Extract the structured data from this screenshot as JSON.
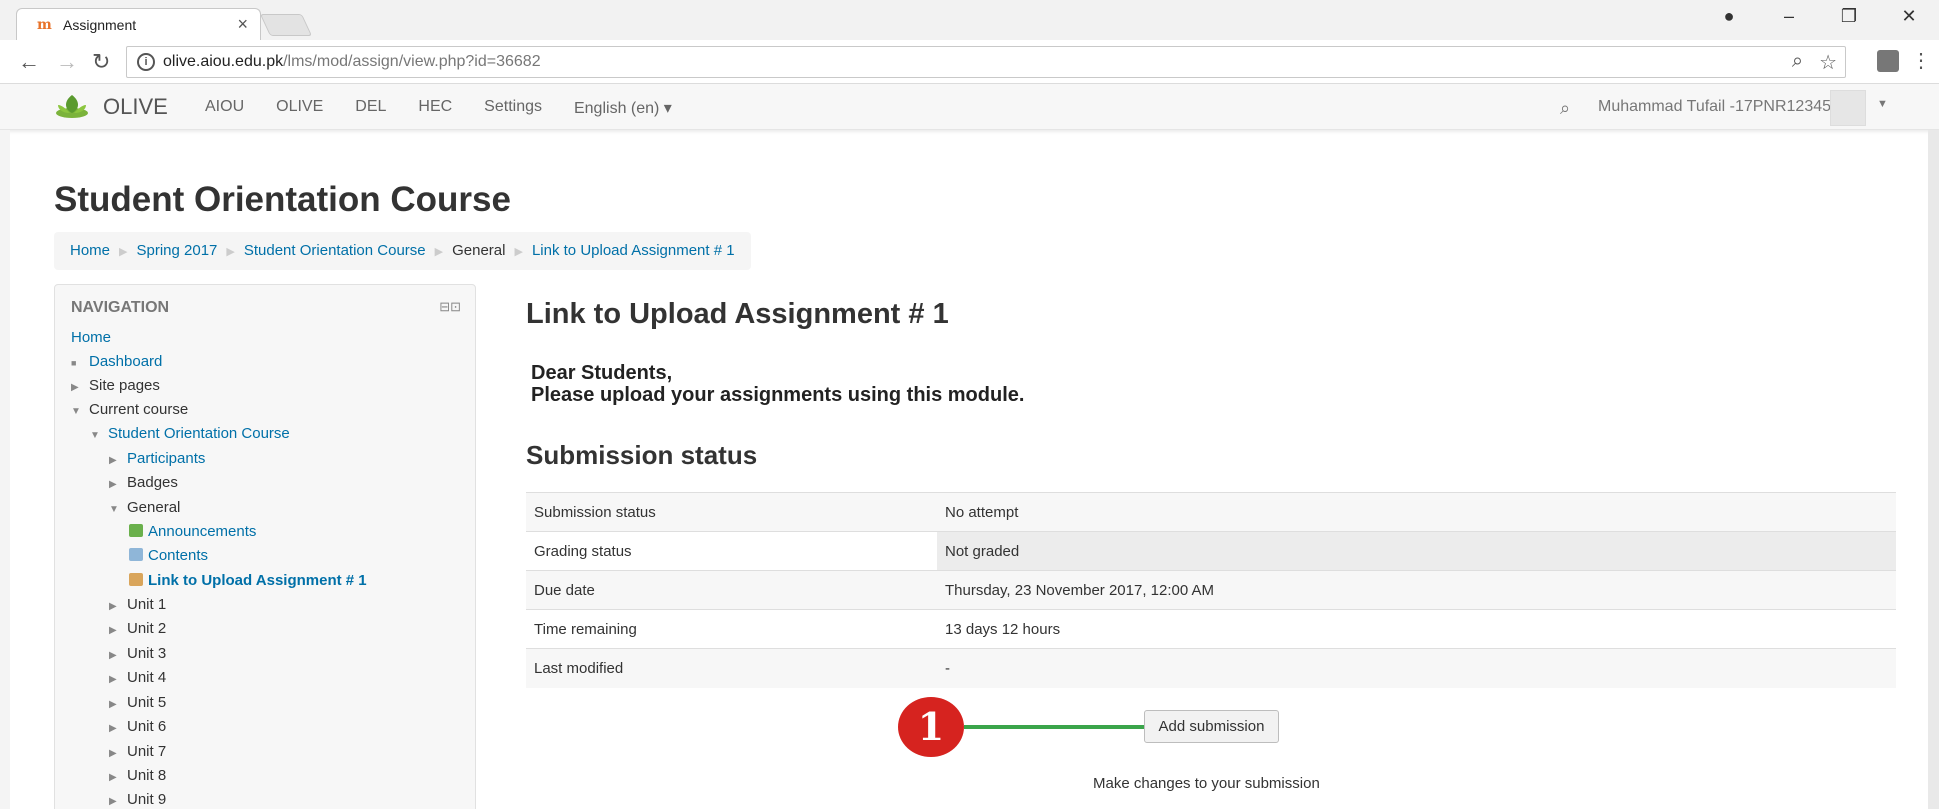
{
  "browser": {
    "tab_title": "Assignment",
    "tab_favicon": "moodle-icon",
    "url_host": "olive.aiou.edu.pk",
    "url_path": "/lms/mod/assign/view.php?id=36682"
  },
  "topnav": {
    "brand": "OLIVE",
    "links": [
      "AIOU",
      "OLIVE",
      "DEL",
      "HEC",
      "Settings",
      "English (en) ▾"
    ],
    "user": "Muhammad Tufail -17PNR12345"
  },
  "page": {
    "title": "Student Orientation Course",
    "breadcrumb": [
      "Home",
      "Spring 2017",
      "Student Orientation Course",
      "General",
      "Link to Upload Assignment # 1"
    ]
  },
  "navigation": {
    "title": "NAVIGATION",
    "items": [
      {
        "label": "Home"
      },
      {
        "label": "Dashboard"
      },
      {
        "label": "Site pages"
      },
      {
        "label": "Current course"
      },
      {
        "label": "Student Orientation Course"
      },
      {
        "label": "Participants"
      },
      {
        "label": "Badges"
      },
      {
        "label": "General"
      },
      {
        "label": "Announcements"
      },
      {
        "label": "Contents"
      },
      {
        "label": "Link to Upload Assignment # 1"
      },
      {
        "label": "Unit 1"
      },
      {
        "label": "Unit 2"
      },
      {
        "label": "Unit 3"
      },
      {
        "label": "Unit 4"
      },
      {
        "label": "Unit 5"
      },
      {
        "label": "Unit 6"
      },
      {
        "label": "Unit 7"
      },
      {
        "label": "Unit 8"
      },
      {
        "label": "Unit 9"
      }
    ]
  },
  "main": {
    "heading": "Link to Upload Assignment # 1",
    "intro_line1": "Dear Students,",
    "intro_line2": "Please upload your assignments using this module.",
    "status_heading": "Submission status",
    "rows": [
      {
        "key": "Submission status",
        "value": "No attempt"
      },
      {
        "key": "Grading status",
        "value": "Not graded"
      },
      {
        "key": "Due date",
        "value": "Thursday, 23 November 2017, 12:00 AM"
      },
      {
        "key": "Time remaining",
        "value": "13 days 12 hours"
      },
      {
        "key": "Last modified",
        "value": "-"
      }
    ],
    "callout_number": "1",
    "add_button": "Add submission",
    "help_text": "Make changes to your submission"
  }
}
